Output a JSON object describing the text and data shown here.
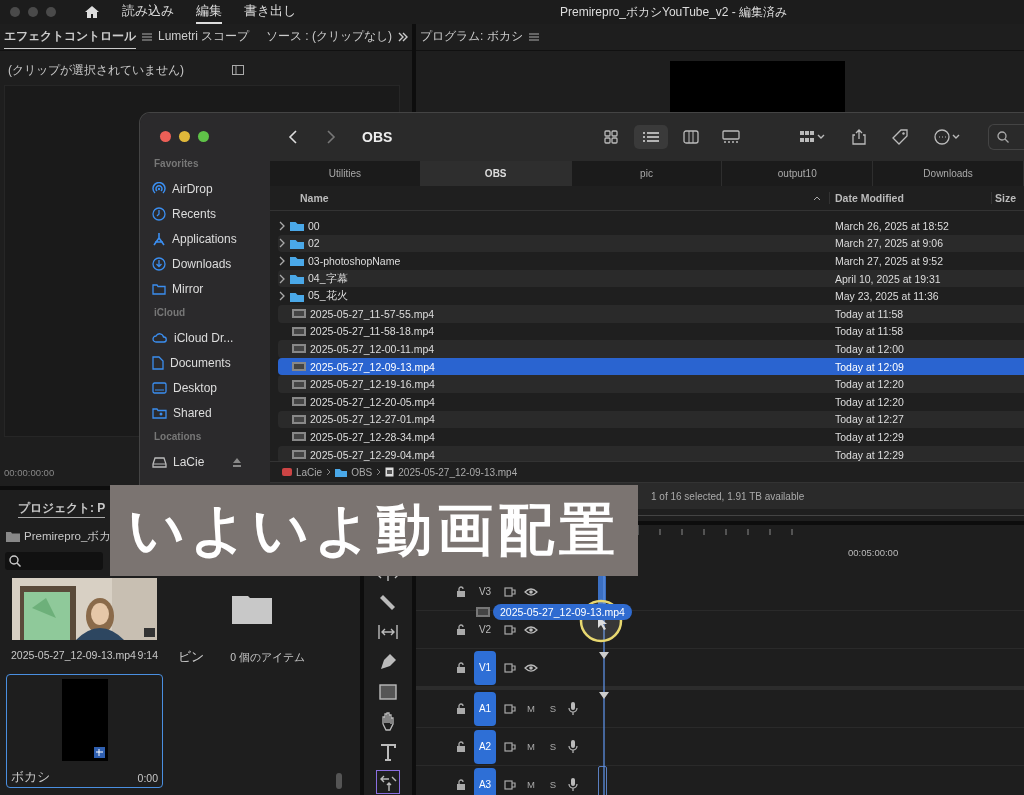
{
  "menubar": {
    "tabs": [
      {
        "label": "読み込み",
        "selected": false
      },
      {
        "label": "編集",
        "selected": true
      },
      {
        "label": "書き出し",
        "selected": false
      }
    ],
    "title": "Premirepro_ボカシYouTube_v2 - 編集済み"
  },
  "effects_panel": {
    "tabs": [
      {
        "label": "エフェクトコントロール",
        "selected": true
      },
      {
        "label": "Lumetri スコープ",
        "selected": false
      },
      {
        "label": "ソース : (クリップなし)",
        "selected": false
      }
    ],
    "message": "(クリップが選択されていません)",
    "timecode": "00:00:00:00"
  },
  "program_panel": {
    "title": "プログラム: ボカシ"
  },
  "project_panel": {
    "tab": "プロジェクト: P",
    "path": "Premirepro_ボカ",
    "items": [
      {
        "kind": "clip",
        "name": "2025-05-27_12-09-13.mp4",
        "info": "9:14",
        "selected": false
      },
      {
        "kind": "bin",
        "name": "ビン",
        "info": "0 個のアイテム",
        "selected": false
      },
      {
        "kind": "sequence",
        "name": "ボカシ",
        "info": "0:00",
        "selected": true
      }
    ]
  },
  "timeline": {
    "ruler_label": "00:05:00:00",
    "dragged_clip": "2025-05-27_12-09-13.mp4",
    "tracks": [
      {
        "kind": "video",
        "name": "V3",
        "targeted": false
      },
      {
        "kind": "video",
        "name": "V2",
        "targeted": false
      },
      {
        "kind": "video",
        "name": "V1",
        "targeted": true
      },
      {
        "kind": "audio",
        "name": "A1",
        "targeted": true,
        "mute": "M",
        "solo": "S"
      },
      {
        "kind": "audio",
        "name": "A2",
        "targeted": true,
        "mute": "M",
        "solo": "S"
      },
      {
        "kind": "audio",
        "name": "A3",
        "targeted": true,
        "mute": "M",
        "solo": "S"
      }
    ]
  },
  "finder": {
    "title": "OBS",
    "sidebar": [
      {
        "heading": "Favorites",
        "items": [
          {
            "kind": "airdrop",
            "label": "AirDrop"
          },
          {
            "kind": "recents",
            "label": "Recents"
          },
          {
            "kind": "applications",
            "label": "Applications"
          },
          {
            "kind": "downloads",
            "label": "Downloads"
          },
          {
            "kind": "folder",
            "label": "Mirror"
          }
        ]
      },
      {
        "heading": "iCloud",
        "items": [
          {
            "kind": "cloud",
            "label": "iCloud Dr..."
          },
          {
            "kind": "document",
            "label": "Documents"
          },
          {
            "kind": "desktop",
            "label": "Desktop"
          },
          {
            "kind": "shared",
            "label": "Shared"
          }
        ]
      },
      {
        "heading": "Locations",
        "items": [
          {
            "kind": "drive",
            "label": "LaCie"
          }
        ]
      }
    ],
    "tabs": [
      {
        "label": "Utilities",
        "selected": false
      },
      {
        "label": "OBS",
        "selected": true
      },
      {
        "label": "pic",
        "selected": false
      },
      {
        "label": "output10",
        "selected": false
      },
      {
        "label": "Downloads",
        "selected": false
      }
    ],
    "columns": [
      "Name",
      "Date Modified",
      "Size"
    ],
    "rows": [
      {
        "kind": "folder",
        "name": "00",
        "date": "March 26, 2025 at 18:52",
        "selected": false
      },
      {
        "kind": "folder",
        "name": "02",
        "date": "March 27, 2025 at 9:06",
        "selected": false
      },
      {
        "kind": "folder",
        "name": "03-photoshopName",
        "date": "March 27, 2025 at 9:52",
        "selected": false
      },
      {
        "kind": "folder",
        "name": "04_字幕",
        "date": "April 10, 2025 at 19:31",
        "selected": false
      },
      {
        "kind": "folder",
        "name": "05_花火",
        "date": "May 23, 2025 at 11:36",
        "selected": false
      },
      {
        "kind": "video",
        "name": "2025-05-27_11-57-55.mp4",
        "date": "Today at 11:58",
        "selected": false
      },
      {
        "kind": "video",
        "name": "2025-05-27_11-58-18.mp4",
        "date": "Today at 11:58",
        "selected": false
      },
      {
        "kind": "video",
        "name": "2025-05-27_12-00-11.mp4",
        "date": "Today at 12:00",
        "selected": false
      },
      {
        "kind": "video",
        "name": "2025-05-27_12-09-13.mp4",
        "date": "Today at 12:09",
        "selected": true
      },
      {
        "kind": "video",
        "name": "2025-05-27_12-19-16.mp4",
        "date": "Today at 12:20",
        "selected": false
      },
      {
        "kind": "video",
        "name": "2025-05-27_12-20-05.mp4",
        "date": "Today at 12:20",
        "selected": false
      },
      {
        "kind": "video",
        "name": "2025-05-27_12-27-01.mp4",
        "date": "Today at 12:27",
        "selected": false
      },
      {
        "kind": "video",
        "name": "2025-05-27_12-28-34.mp4",
        "date": "Today at 12:29",
        "selected": false
      },
      {
        "kind": "video",
        "name": "2025-05-27_12-29-04.mp4",
        "date": "Today at 12:29",
        "selected": false
      }
    ],
    "path": [
      "LaCie",
      "OBS",
      "2025-05-27_12-09-13.mp4"
    ],
    "status": "1 of 16 selected, 1.91 TB available"
  },
  "caption": "いよいよ動画配置"
}
